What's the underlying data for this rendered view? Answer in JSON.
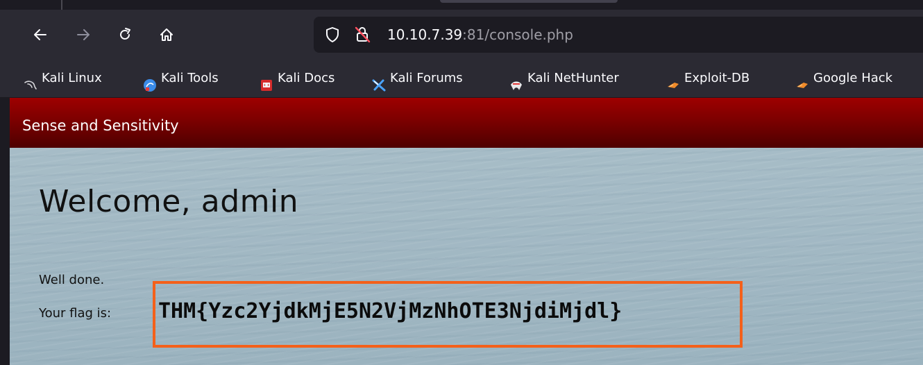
{
  "browser": {
    "url_host": "10.10.7.39",
    "url_rest": ":81/console.php",
    "icons": {
      "back": "arrow-left-icon",
      "forward": "arrow-right-icon",
      "reload": "reload-icon",
      "home": "home-icon",
      "tracking": "shield-icon",
      "security": "insecure-lock-icon"
    }
  },
  "bookmarks": [
    {
      "label": "Kali Linux",
      "icon": "kali-dragon-icon"
    },
    {
      "label": "Kali Tools",
      "icon": "kali-tools-icon"
    },
    {
      "label": "Kali Docs",
      "icon": "kali-docs-icon"
    },
    {
      "label": "Kali Forums",
      "icon": "kali-forums-icon"
    },
    {
      "label": "Kali NetHunter",
      "icon": "kali-nethunter-icon"
    },
    {
      "label": "Exploit-DB",
      "icon": "exploit-db-icon"
    },
    {
      "label": "Google Hack",
      "icon": "google-hacking-icon"
    }
  ],
  "page": {
    "site_title": "Sense and Sensitivity",
    "heading": "Welcome, admin",
    "message": "Well done.",
    "flag_label": "Your flag is:",
    "flag_value": "THM{Yzc2YjdkMjE5N2VjMzNhOTE3NjdiMjdl}"
  },
  "colors": {
    "header_red": "#8b0000",
    "highlight": "#f4601a",
    "toolbar": "#2b2a33",
    "urlbar": "#1c1b22"
  }
}
